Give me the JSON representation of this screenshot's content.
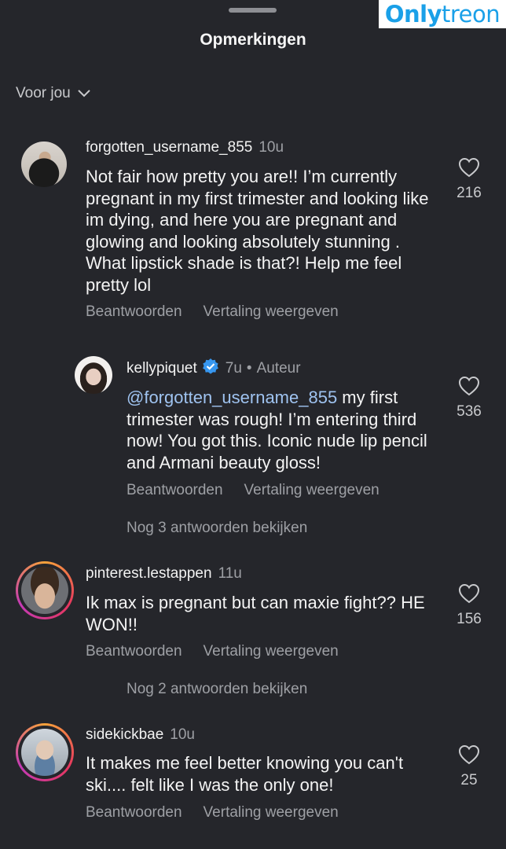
{
  "watermark": {
    "part1": "Only",
    "part2": "treon"
  },
  "header": {
    "title": "Opmerkingen"
  },
  "filter": {
    "label": "Voor jou"
  },
  "comments": [
    {
      "username": "forgotten_username_855",
      "time": "10u",
      "text": "Not fair how pretty you are!! I’m currently pregnant in my first trimester and looking like im dying, and here you are pregnant and glowing and looking absolutely stunning . What lipstick shade is that?! Help me feel pretty lol",
      "likes": "216",
      "reply_label": "Beantwoorden",
      "translate_label": "Vertaling weergeven"
    },
    {
      "username": "kellypiquet",
      "time": "7u",
      "author_tag": "Auteur",
      "mention": "@forgotten_username_855",
      "text": " my first trimester was rough! I’m entering third now! You got this. Iconic nude lip pencil and Armani beauty gloss!",
      "likes": "536",
      "reply_label": "Beantwoorden",
      "translate_label": "Vertaling weergeven",
      "more_replies": "Nog 3 antwoorden bekijken"
    },
    {
      "username": "pinterest.lestappen",
      "time": "11u",
      "text": "Ik max is pregnant but can maxie fight?? HE WON!!",
      "likes": "156",
      "reply_label": "Beantwoorden",
      "translate_label": "Vertaling weergeven",
      "more_replies": "Nog 2 antwoorden bekijken"
    },
    {
      "username": "sidekickbae",
      "time": "10u",
      "text": "It makes me feel better knowing you can't ski.... felt like I was the only one!",
      "likes": "25",
      "reply_label": "Beantwoorden",
      "translate_label": "Vertaling weergeven"
    }
  ],
  "colors": {
    "background": "#25262b",
    "mention": "#9fc3f0",
    "verified": "#3797f0",
    "secondary_text": "#9ea0a5"
  }
}
